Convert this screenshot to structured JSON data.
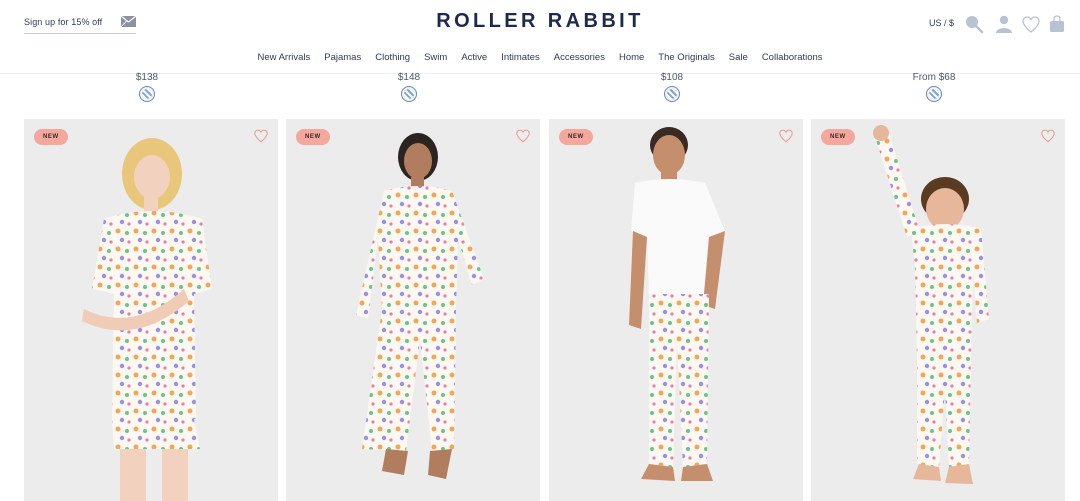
{
  "header": {
    "signup_text": "Sign up for 15% off",
    "logo": "ROLLER RABBIT",
    "currency": "US / $",
    "icons": [
      "mail-icon",
      "search-icon",
      "account-icon",
      "wishlist-icon",
      "bag-icon"
    ]
  },
  "nav": {
    "items": [
      "New Arrivals",
      "Pajamas",
      "Clothing",
      "Swim",
      "Active",
      "Intimates",
      "Accessories",
      "Home",
      "The Originals",
      "Sale",
      "Collaborations"
    ]
  },
  "previous_row": {
    "prices": [
      "$138",
      "$148",
      "$108",
      "From $68"
    ]
  },
  "products": [
    {
      "badge": "NEW",
      "subject": "woman-short-pajama"
    },
    {
      "badge": "NEW",
      "subject": "woman-long-pajama"
    },
    {
      "badge": "NEW",
      "subject": "man-pajama-pants"
    },
    {
      "badge": "NEW",
      "subject": "kid-pajama-set"
    }
  ],
  "colors": {
    "brand_navy": "#1d2a4d",
    "badge_pink": "#f4a79c",
    "heart_outline": "#e8a08f",
    "card_bg": "#ececec"
  }
}
